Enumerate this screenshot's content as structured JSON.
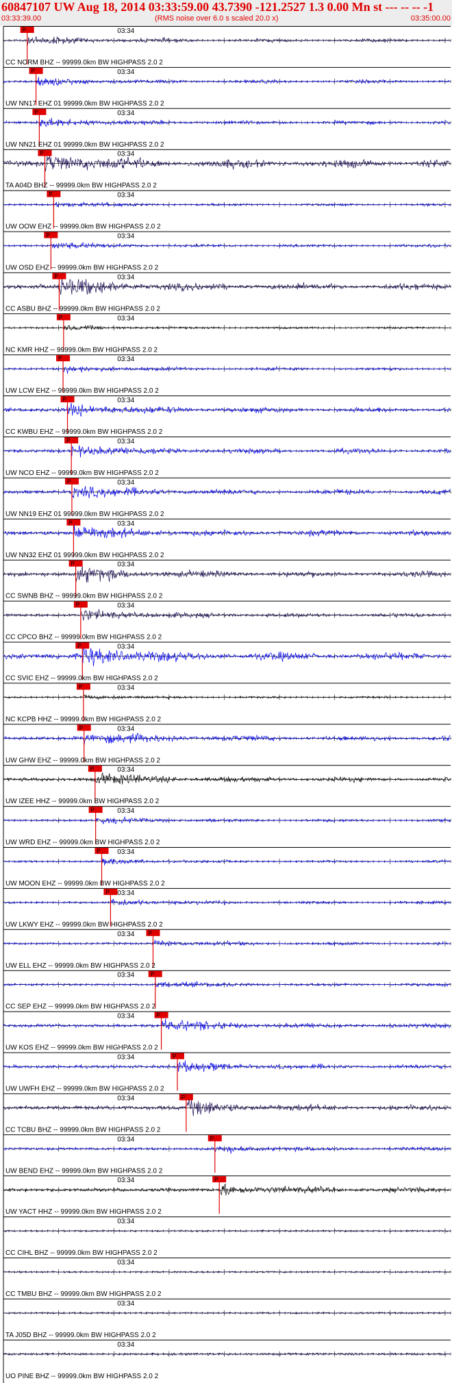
{
  "header": {
    "title": "60847107 UW Aug 18, 2014 03:33:59.00   43.7390 -121.2527  1.3 0.00 Mn st --- -- --  -1",
    "start_time": "03:33:39.00",
    "note": "(RMS noise over 6.0 s scaled 20.0 x)",
    "end_time": "03:35:00.00"
  },
  "colors": {
    "dark": "#1a0a52",
    "blue": "#0000ee",
    "black": "#000000",
    "pick": "#e00000"
  },
  "chart_data": {
    "type": "line",
    "title": "",
    "x_label": "",
    "x_start": "03:33:39.00",
    "x_end": "03:35:00.00",
    "minute_tick_label": "03:34",
    "pick_label": "P",
    "grid": false,
    "series": [
      {
        "name": "CC NORM BHZ -- 99999.0km BW  HIGHPASS  2.0  2",
        "color": "dark",
        "pick_s": 4.3,
        "amp": 0.35
      },
      {
        "name": "UW NN17 EHZ 01 99999.0km BW  HIGHPASS  2.0  2",
        "color": "blue",
        "pick_s": 5.9,
        "amp": 0.35
      },
      {
        "name": "UW NN21 EHZ 01 99999.0km BW  HIGHPASS  2.0  2",
        "color": "blue",
        "pick_s": 6.5,
        "amp": 0.4
      },
      {
        "name": "TA A04D BHZ -- 99999.0km BW  HIGHPASS  2.0  2",
        "color": "dark",
        "pick_s": 7.5,
        "amp": 0.85
      },
      {
        "name": "UW OOW EHZ -- 99999.0km BW  HIGHPASS  2.0  2",
        "color": "blue",
        "pick_s": 9.1,
        "amp": 0.25
      },
      {
        "name": "UW OSD EHZ -- 99999.0km BW  HIGHPASS  2.0  2",
        "color": "blue",
        "pick_s": 8.6,
        "amp": 0.3
      },
      {
        "name": "CC ASBU BHZ -- 99999.0km BW  HIGHPASS  2.0  2",
        "color": "dark",
        "pick_s": 10.1,
        "amp": 0.7
      },
      {
        "name": "NC KMR HHZ -- 99999.0km BW  HIGHPASS  2.0  2",
        "color": "black",
        "pick_s": 10.9,
        "amp": 0.2
      },
      {
        "name": "UW LCW EHZ -- 99999.0km BW  HIGHPASS  2.0  2",
        "color": "blue",
        "pick_s": 10.8,
        "amp": 0.3
      },
      {
        "name": "CC KWBU EHZ -- 99999.0km BW  HIGHPASS  2.0  2",
        "color": "blue",
        "pick_s": 11.6,
        "amp": 0.55
      },
      {
        "name": "UW NCO EHZ -- 99999.0km BW  HIGHPASS  2.0  2",
        "color": "blue",
        "pick_s": 12.3,
        "amp": 0.5
      },
      {
        "name": "UW NN19 EHZ 01 99999.0km BW  HIGHPASS  2.0  2",
        "color": "blue",
        "pick_s": 12.4,
        "amp": 0.55
      },
      {
        "name": "UW NN32 EHZ 01 99999.0km BW  HIGHPASS  2.0  2",
        "color": "blue",
        "pick_s": 12.7,
        "amp": 0.6
      },
      {
        "name": "CC SWNB BHZ -- 99999.0km BW  HIGHPASS  2.0  2",
        "color": "dark",
        "pick_s": 13.1,
        "amp": 0.6
      },
      {
        "name": "CC CPCO BHZ -- 99999.0km BW  HIGHPASS  2.0  2",
        "color": "dark",
        "pick_s": 14.0,
        "amp": 0.45
      },
      {
        "name": "CC SVIC EHZ -- 99999.0km BW  HIGHPASS  2.0  2",
        "color": "blue",
        "pick_s": 14.3,
        "amp": 0.8
      },
      {
        "name": "NC KCPB HHZ -- 99999.0km BW  HIGHPASS  2.0  2",
        "color": "black",
        "pick_s": 14.5,
        "amp": 0.2
      },
      {
        "name": "UW GHW EHZ -- 99999.0km BW  HIGHPASS  2.0  2",
        "color": "blue",
        "pick_s": 14.6,
        "amp": 0.55
      },
      {
        "name": "UW IZEE HHZ -- 99999.0km BW  HIGHPASS  2.0  2",
        "color": "black",
        "pick_s": 16.6,
        "amp": 0.5
      },
      {
        "name": "UW WRD EHZ -- 99999.0km BW  HIGHPASS  2.0  2",
        "color": "blue",
        "pick_s": 16.7,
        "amp": 0.3
      },
      {
        "name": "UW MOON EHZ -- 99999.0km BW  HIGHPASS  2.0  2",
        "color": "blue",
        "pick_s": 17.8,
        "amp": 0.25
      },
      {
        "name": "UW LKWY EHZ -- 99999.0km BW  HIGHPASS  2.0  2",
        "color": "blue",
        "pick_s": 19.4,
        "amp": 0.3
      },
      {
        "name": "UW ELL EHZ -- 99999.0km BW  HIGHPASS  2.0  2",
        "color": "blue",
        "pick_s": 27.1,
        "amp": 0.3
      },
      {
        "name": "CC SEP EHZ -- 99999.0km BW  HIGHPASS  2.0  2",
        "color": "blue",
        "pick_s": 27.5,
        "amp": 0.3
      },
      {
        "name": "UW KOS EHZ -- 99999.0km BW  HIGHPASS  2.0  2",
        "color": "blue",
        "pick_s": 28.6,
        "amp": 0.5
      },
      {
        "name": "UW UWFH EHZ -- 99999.0km BW  HIGHPASS  2.0  2",
        "color": "blue",
        "pick_s": 31.5,
        "amp": 0.45
      },
      {
        "name": "CC TCBU BHZ -- 99999.0km BW  HIGHPASS  2.0  2",
        "color": "dark",
        "pick_s": 33.1,
        "amp": 0.6
      },
      {
        "name": "UW BEND EHZ -- 99999.0km BW  HIGHPASS  2.0  2",
        "color": "blue",
        "pick_s": 38.3,
        "amp": 0.35
      },
      {
        "name": "UW YACT HHZ -- 99999.0km BW  HIGHPASS  2.0  2",
        "color": "black",
        "pick_s": 39.1,
        "amp": 0.5
      },
      {
        "name": "CC CIHL BHZ -- 99999.0km BW  HIGHPASS  2.0  2",
        "color": "dark",
        "pick_s": null,
        "amp": 0.25
      },
      {
        "name": "CC TMBU BHZ -- 99999.0km BW  HIGHPASS  2.0  2",
        "color": "dark",
        "pick_s": null,
        "amp": 0.25
      },
      {
        "name": "TA J05D BHZ -- 99999.0km BW  HIGHPASS  2.0  2",
        "color": "dark",
        "pick_s": null,
        "amp": 0.25
      },
      {
        "name": "UO PINE BHZ -- 99999.0km BW  HIGHPASS  2.0  2",
        "color": "dark",
        "pick_s": null,
        "amp": 0.35
      }
    ]
  }
}
